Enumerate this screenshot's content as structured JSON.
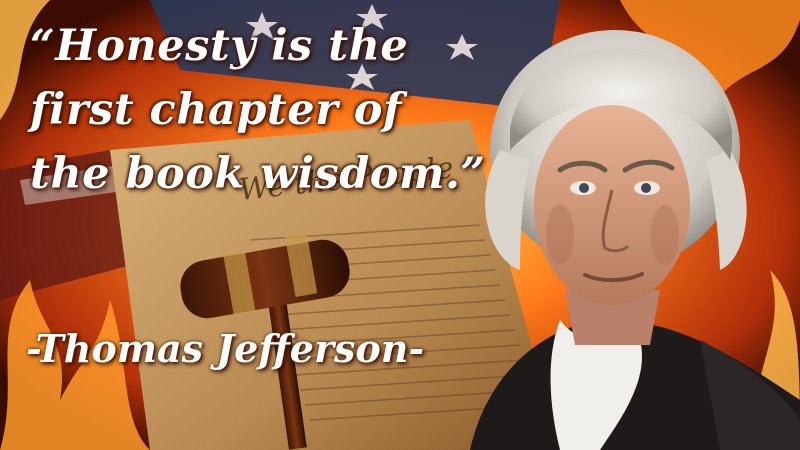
{
  "quote": {
    "lines": [
      "“Honesty is the",
      "first chapter of",
      "the book wisdom.”"
    ]
  },
  "attribution": "-Thomas Jefferson-",
  "document_text": [
    "We the People"
  ],
  "colors": {
    "text": "#ffffff",
    "fire": "#ff7a1a",
    "parchment": "#c9a06a",
    "flag_blue": "#2a3a5a"
  }
}
